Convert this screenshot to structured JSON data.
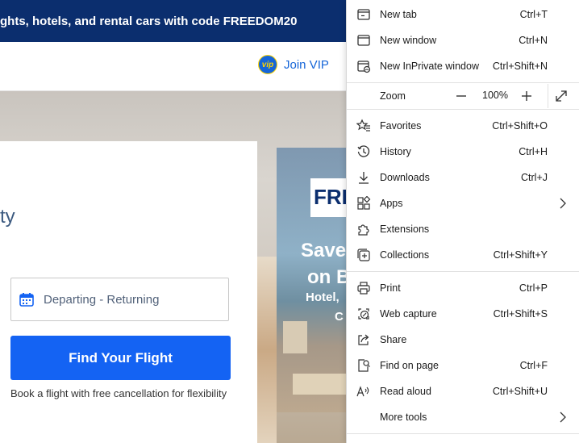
{
  "banner": {
    "text": "ghts, hotels, and rental cars with code FREEDOM20"
  },
  "header": {
    "vip_badge": "vip",
    "vip_label": "Join VIP"
  },
  "hero": {
    "partial_heading": "ty",
    "date_field": "Departing - Returning",
    "find_button": "Find Your Flight",
    "note": "Book a flight with free cancellation for flexibility"
  },
  "promo": {
    "logo": "FRE",
    "save": "Save",
    "on": "on B",
    "hotel": "Hotel,",
    "c": "C"
  },
  "menu": {
    "new_tab": {
      "label": "New tab",
      "shortcut": "Ctrl+T"
    },
    "new_window": {
      "label": "New window",
      "shortcut": "Ctrl+N"
    },
    "new_inprivate": {
      "label": "New InPrivate window",
      "shortcut": "Ctrl+Shift+N"
    },
    "zoom": {
      "label": "Zoom",
      "value": "100%"
    },
    "favorites": {
      "label": "Favorites",
      "shortcut": "Ctrl+Shift+O"
    },
    "history": {
      "label": "History",
      "shortcut": "Ctrl+H"
    },
    "downloads": {
      "label": "Downloads",
      "shortcut": "Ctrl+J"
    },
    "apps": {
      "label": "Apps"
    },
    "extensions": {
      "label": "Extensions"
    },
    "collections": {
      "label": "Collections",
      "shortcut": "Ctrl+Shift+Y"
    },
    "print": {
      "label": "Print",
      "shortcut": "Ctrl+P"
    },
    "web_capture": {
      "label": "Web capture",
      "shortcut": "Ctrl+Shift+S"
    },
    "share": {
      "label": "Share"
    },
    "find_on_page": {
      "label": "Find on page",
      "shortcut": "Ctrl+F"
    },
    "read_aloud": {
      "label": "Read aloud",
      "shortcut": "Ctrl+Shift+U"
    },
    "more_tools": {
      "label": "More tools"
    }
  },
  "colors": {
    "banner": "#0b2e6e",
    "accent": "#1463f3",
    "vip": "#1565d8"
  }
}
